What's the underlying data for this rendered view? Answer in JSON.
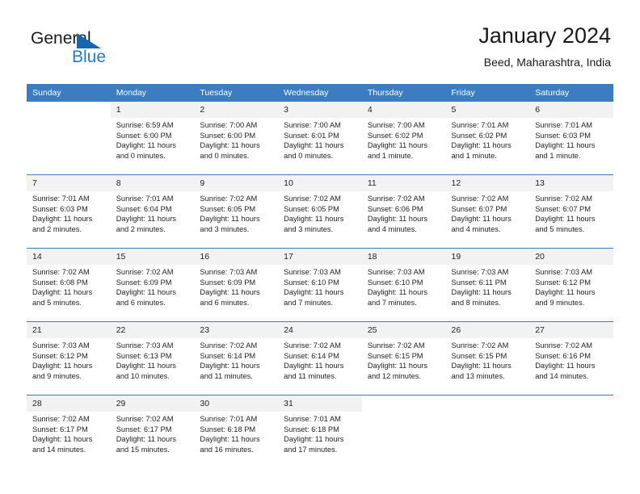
{
  "brand": {
    "name_part1": "General",
    "name_part2": "Blue",
    "triangle_color": "#1567b4",
    "blue_color": "#1e7fd0"
  },
  "header": {
    "title": "January 2024",
    "subtitle": "Beed, Maharashtra, India"
  },
  "theme": {
    "header_bg": "#3c7cc0",
    "daynum_bg": "#f2f2f2",
    "separator": "#3c7cc0"
  },
  "weekdays": [
    "Sunday",
    "Monday",
    "Tuesday",
    "Wednesday",
    "Thursday",
    "Friday",
    "Saturday"
  ],
  "weeks": [
    [
      {
        "day": "",
        "sunrise": "",
        "sunset": "",
        "daylight1": "",
        "daylight2": ""
      },
      {
        "day": "1",
        "sunrise": "Sunrise: 6:59 AM",
        "sunset": "Sunset: 6:00 PM",
        "daylight1": "Daylight: 11 hours",
        "daylight2": "and 0 minutes."
      },
      {
        "day": "2",
        "sunrise": "Sunrise: 7:00 AM",
        "sunset": "Sunset: 6:00 PM",
        "daylight1": "Daylight: 11 hours",
        "daylight2": "and 0 minutes."
      },
      {
        "day": "3",
        "sunrise": "Sunrise: 7:00 AM",
        "sunset": "Sunset: 6:01 PM",
        "daylight1": "Daylight: 11 hours",
        "daylight2": "and 0 minutes."
      },
      {
        "day": "4",
        "sunrise": "Sunrise: 7:00 AM",
        "sunset": "Sunset: 6:02 PM",
        "daylight1": "Daylight: 11 hours",
        "daylight2": "and 1 minute."
      },
      {
        "day": "5",
        "sunrise": "Sunrise: 7:01 AM",
        "sunset": "Sunset: 6:02 PM",
        "daylight1": "Daylight: 11 hours",
        "daylight2": "and 1 minute."
      },
      {
        "day": "6",
        "sunrise": "Sunrise: 7:01 AM",
        "sunset": "Sunset: 6:03 PM",
        "daylight1": "Daylight: 11 hours",
        "daylight2": "and 1 minute."
      }
    ],
    [
      {
        "day": "7",
        "sunrise": "Sunrise: 7:01 AM",
        "sunset": "Sunset: 6:03 PM",
        "daylight1": "Daylight: 11 hours",
        "daylight2": "and 2 minutes."
      },
      {
        "day": "8",
        "sunrise": "Sunrise: 7:01 AM",
        "sunset": "Sunset: 6:04 PM",
        "daylight1": "Daylight: 11 hours",
        "daylight2": "and 2 minutes."
      },
      {
        "day": "9",
        "sunrise": "Sunrise: 7:02 AM",
        "sunset": "Sunset: 6:05 PM",
        "daylight1": "Daylight: 11 hours",
        "daylight2": "and 3 minutes."
      },
      {
        "day": "10",
        "sunrise": "Sunrise: 7:02 AM",
        "sunset": "Sunset: 6:05 PM",
        "daylight1": "Daylight: 11 hours",
        "daylight2": "and 3 minutes."
      },
      {
        "day": "11",
        "sunrise": "Sunrise: 7:02 AM",
        "sunset": "Sunset: 6:06 PM",
        "daylight1": "Daylight: 11 hours",
        "daylight2": "and 4 minutes."
      },
      {
        "day": "12",
        "sunrise": "Sunrise: 7:02 AM",
        "sunset": "Sunset: 6:07 PM",
        "daylight1": "Daylight: 11 hours",
        "daylight2": "and 4 minutes."
      },
      {
        "day": "13",
        "sunrise": "Sunrise: 7:02 AM",
        "sunset": "Sunset: 6:07 PM",
        "daylight1": "Daylight: 11 hours",
        "daylight2": "and 5 minutes."
      }
    ],
    [
      {
        "day": "14",
        "sunrise": "Sunrise: 7:02 AM",
        "sunset": "Sunset: 6:08 PM",
        "daylight1": "Daylight: 11 hours",
        "daylight2": "and 5 minutes."
      },
      {
        "day": "15",
        "sunrise": "Sunrise: 7:02 AM",
        "sunset": "Sunset: 6:09 PM",
        "daylight1": "Daylight: 11 hours",
        "daylight2": "and 6 minutes."
      },
      {
        "day": "16",
        "sunrise": "Sunrise: 7:03 AM",
        "sunset": "Sunset: 6:09 PM",
        "daylight1": "Daylight: 11 hours",
        "daylight2": "and 6 minutes."
      },
      {
        "day": "17",
        "sunrise": "Sunrise: 7:03 AM",
        "sunset": "Sunset: 6:10 PM",
        "daylight1": "Daylight: 11 hours",
        "daylight2": "and 7 minutes."
      },
      {
        "day": "18",
        "sunrise": "Sunrise: 7:03 AM",
        "sunset": "Sunset: 6:10 PM",
        "daylight1": "Daylight: 11 hours",
        "daylight2": "and 7 minutes."
      },
      {
        "day": "19",
        "sunrise": "Sunrise: 7:03 AM",
        "sunset": "Sunset: 6:11 PM",
        "daylight1": "Daylight: 11 hours",
        "daylight2": "and 8 minutes."
      },
      {
        "day": "20",
        "sunrise": "Sunrise: 7:03 AM",
        "sunset": "Sunset: 6:12 PM",
        "daylight1": "Daylight: 11 hours",
        "daylight2": "and 9 minutes."
      }
    ],
    [
      {
        "day": "21",
        "sunrise": "Sunrise: 7:03 AM",
        "sunset": "Sunset: 6:12 PM",
        "daylight1": "Daylight: 11 hours",
        "daylight2": "and 9 minutes."
      },
      {
        "day": "22",
        "sunrise": "Sunrise: 7:03 AM",
        "sunset": "Sunset: 6:13 PM",
        "daylight1": "Daylight: 11 hours",
        "daylight2": "and 10 minutes."
      },
      {
        "day": "23",
        "sunrise": "Sunrise: 7:02 AM",
        "sunset": "Sunset: 6:14 PM",
        "daylight1": "Daylight: 11 hours",
        "daylight2": "and 11 minutes."
      },
      {
        "day": "24",
        "sunrise": "Sunrise: 7:02 AM",
        "sunset": "Sunset: 6:14 PM",
        "daylight1": "Daylight: 11 hours",
        "daylight2": "and 11 minutes."
      },
      {
        "day": "25",
        "sunrise": "Sunrise: 7:02 AM",
        "sunset": "Sunset: 6:15 PM",
        "daylight1": "Daylight: 11 hours",
        "daylight2": "and 12 minutes."
      },
      {
        "day": "26",
        "sunrise": "Sunrise: 7:02 AM",
        "sunset": "Sunset: 6:15 PM",
        "daylight1": "Daylight: 11 hours",
        "daylight2": "and 13 minutes."
      },
      {
        "day": "27",
        "sunrise": "Sunrise: 7:02 AM",
        "sunset": "Sunset: 6:16 PM",
        "daylight1": "Daylight: 11 hours",
        "daylight2": "and 14 minutes."
      }
    ],
    [
      {
        "day": "28",
        "sunrise": "Sunrise: 7:02 AM",
        "sunset": "Sunset: 6:17 PM",
        "daylight1": "Daylight: 11 hours",
        "daylight2": "and 14 minutes."
      },
      {
        "day": "29",
        "sunrise": "Sunrise: 7:02 AM",
        "sunset": "Sunset: 6:17 PM",
        "daylight1": "Daylight: 11 hours",
        "daylight2": "and 15 minutes."
      },
      {
        "day": "30",
        "sunrise": "Sunrise: 7:01 AM",
        "sunset": "Sunset: 6:18 PM",
        "daylight1": "Daylight: 11 hours",
        "daylight2": "and 16 minutes."
      },
      {
        "day": "31",
        "sunrise": "Sunrise: 7:01 AM",
        "sunset": "Sunset: 6:18 PM",
        "daylight1": "Daylight: 11 hours",
        "daylight2": "and 17 minutes."
      },
      {
        "day": "",
        "sunrise": "",
        "sunset": "",
        "daylight1": "",
        "daylight2": ""
      },
      {
        "day": "",
        "sunrise": "",
        "sunset": "",
        "daylight1": "",
        "daylight2": ""
      },
      {
        "day": "",
        "sunrise": "",
        "sunset": "",
        "daylight1": "",
        "daylight2": ""
      }
    ]
  ]
}
